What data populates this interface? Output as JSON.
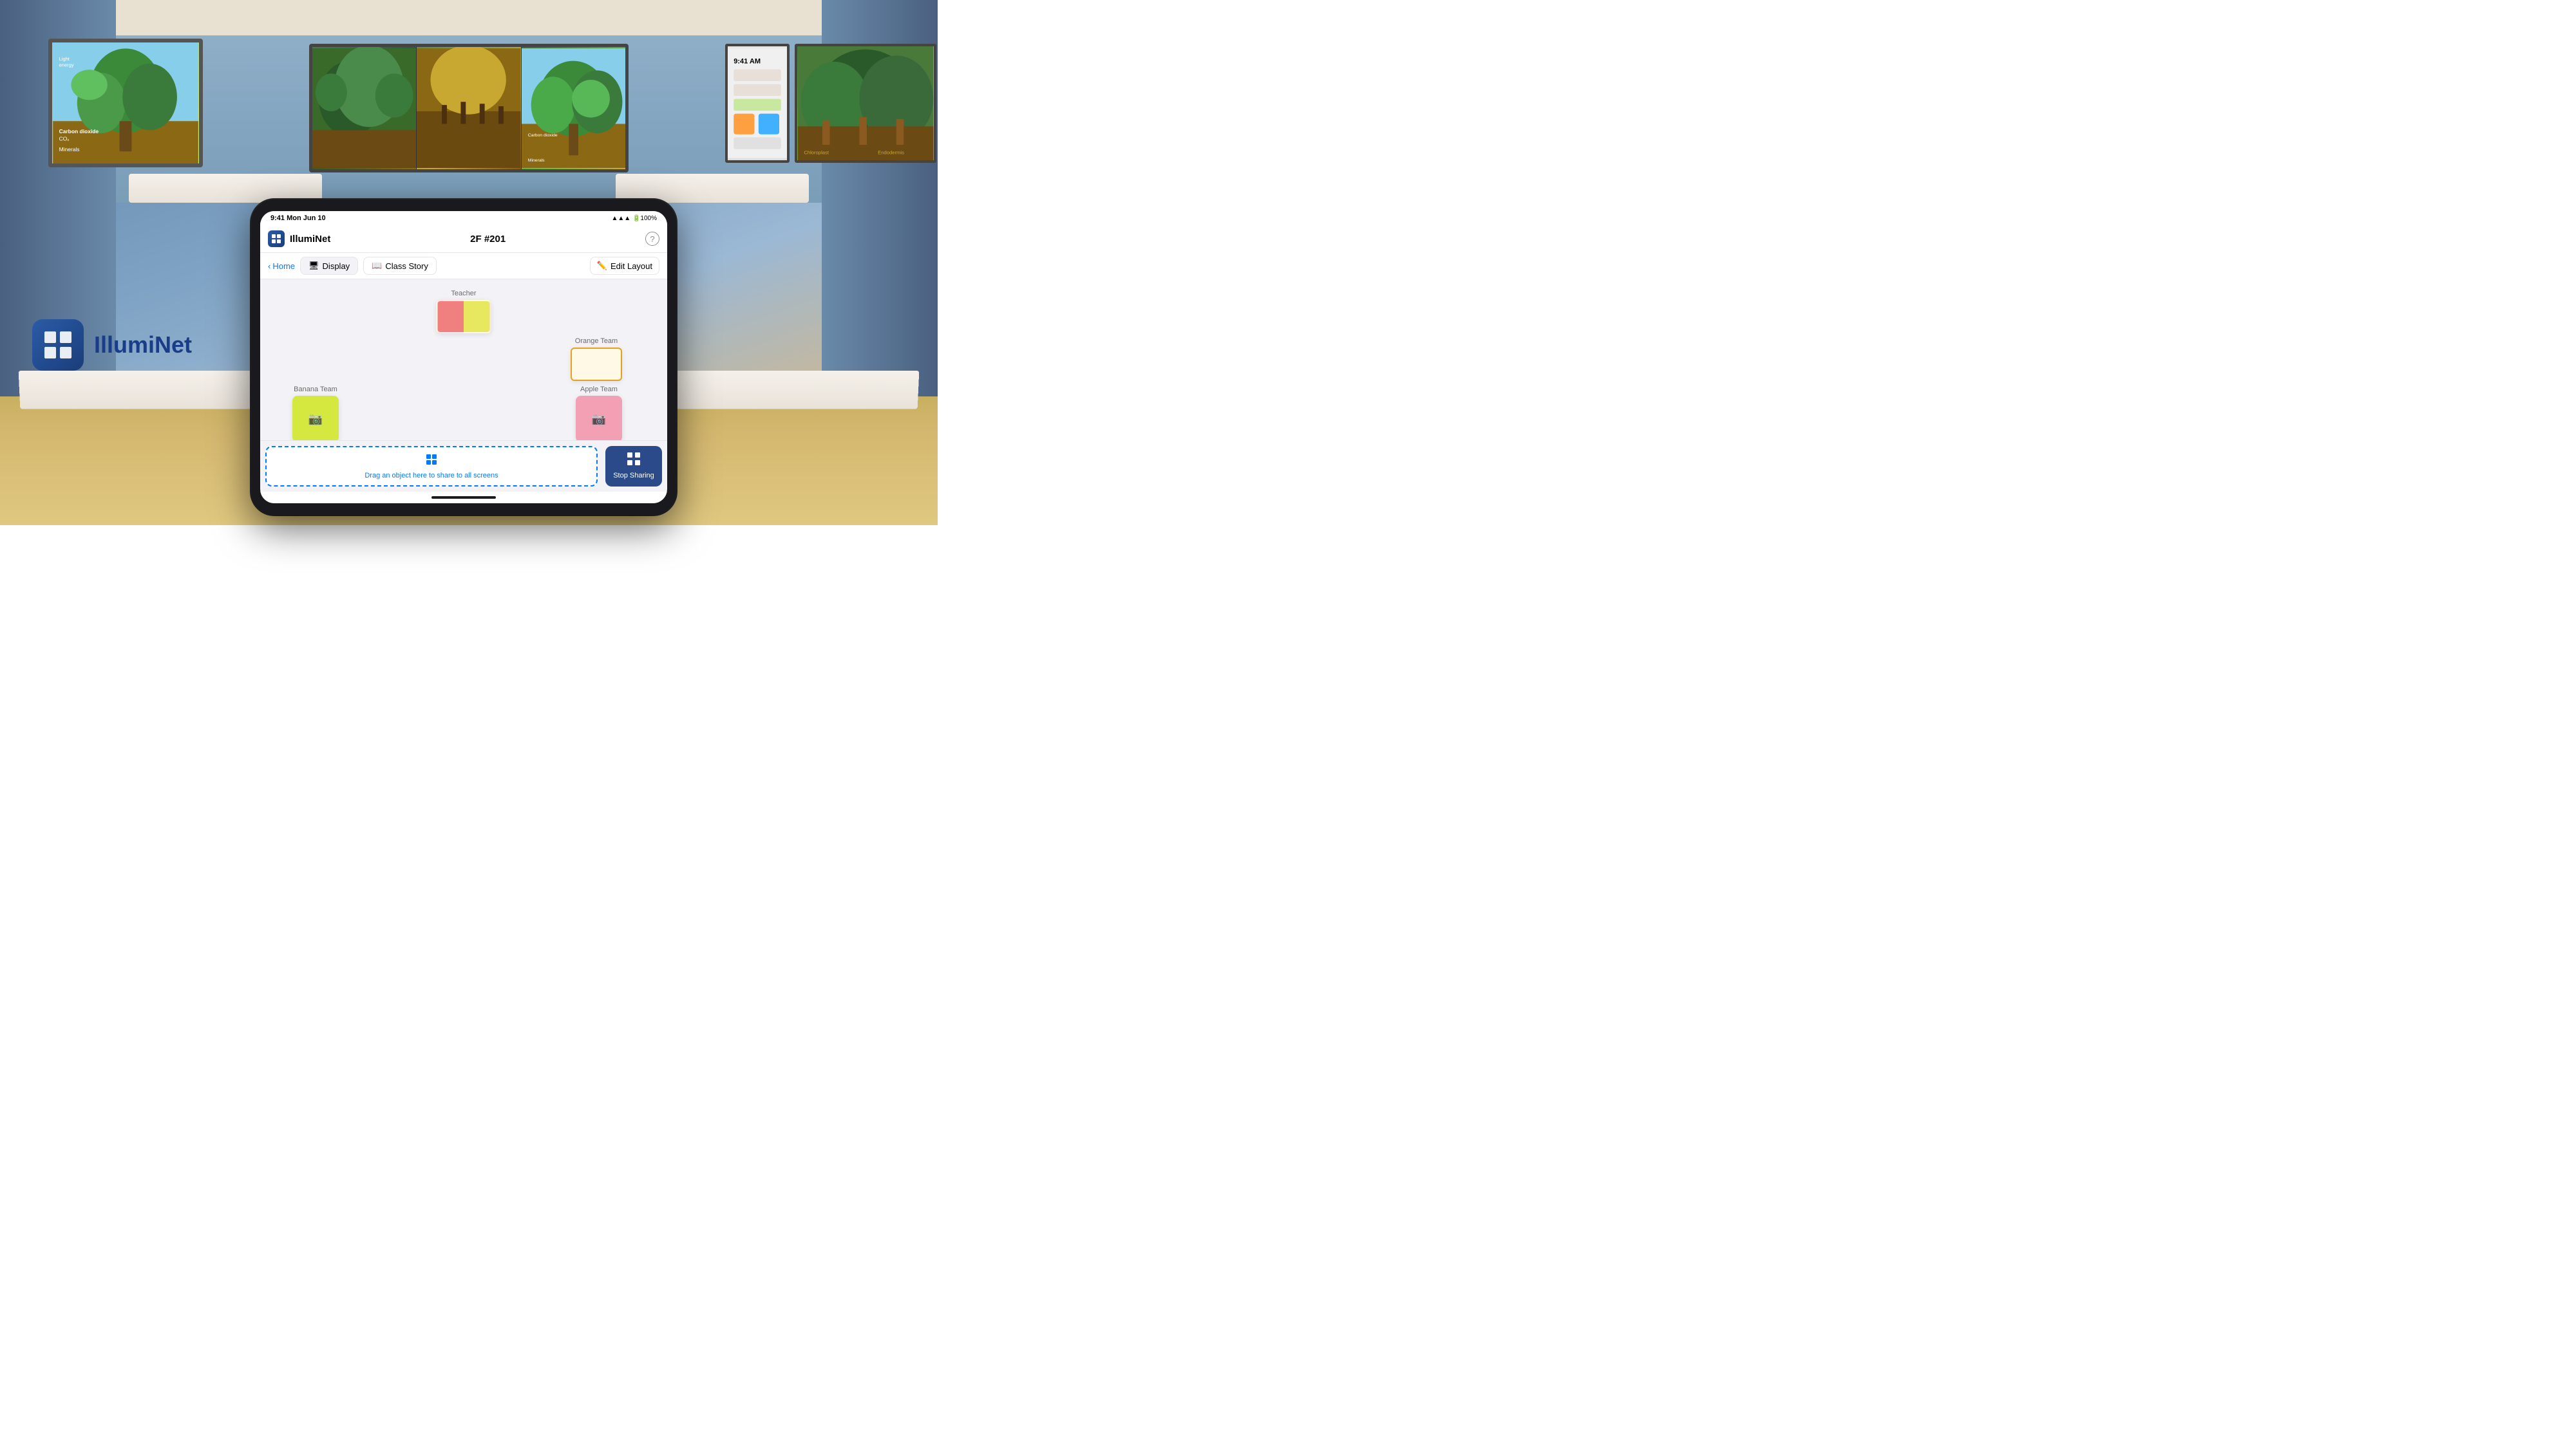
{
  "app": {
    "name": "IllumiNet",
    "room": "2F #201",
    "status_time": "9:41 Mon Jun 10",
    "status_icons": "▲▲▲ 100%",
    "help_label": "?"
  },
  "nav": {
    "back_label": "Home",
    "tabs": [
      {
        "id": "display",
        "label": "Display",
        "icon": "🖥"
      },
      {
        "id": "class_story",
        "label": "Class Story",
        "icon": "📖"
      }
    ],
    "edit_layout_label": "Edit Layout",
    "edit_layout_icon": "✏️"
  },
  "canvas": {
    "teams": [
      {
        "id": "teacher",
        "label": "Teacher",
        "type": "gradient"
      },
      {
        "id": "orange_team",
        "label": "Orange Team",
        "type": "outline"
      },
      {
        "id": "banana_team",
        "label": "Banana Team",
        "icon": "📷",
        "type": "solid_yellow"
      },
      {
        "id": "apple_team",
        "label": "Apple Team",
        "icon": "📷",
        "type": "solid_pink"
      }
    ]
  },
  "drop_zone": {
    "icon": "⊞",
    "text": "Drag an object here to share to all screens"
  },
  "stop_sharing": {
    "icon": "⊞",
    "label": "Stop Sharing"
  },
  "logo": {
    "text": "IllumiNet"
  }
}
